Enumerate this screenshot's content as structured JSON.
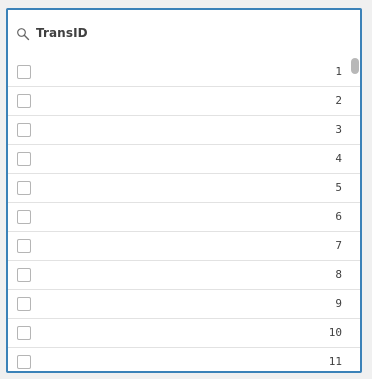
{
  "field": {
    "title": "TransID",
    "icon": "search-icon",
    "accent_color": "#3b82b8"
  },
  "items": [
    {
      "value": "1",
      "checked": false
    },
    {
      "value": "2",
      "checked": false
    },
    {
      "value": "3",
      "checked": false
    },
    {
      "value": "4",
      "checked": false
    },
    {
      "value": "5",
      "checked": false
    },
    {
      "value": "6",
      "checked": false
    },
    {
      "value": "7",
      "checked": false
    },
    {
      "value": "8",
      "checked": false
    },
    {
      "value": "9",
      "checked": false
    },
    {
      "value": "10",
      "checked": false
    },
    {
      "value": "11",
      "checked": false
    }
  ]
}
